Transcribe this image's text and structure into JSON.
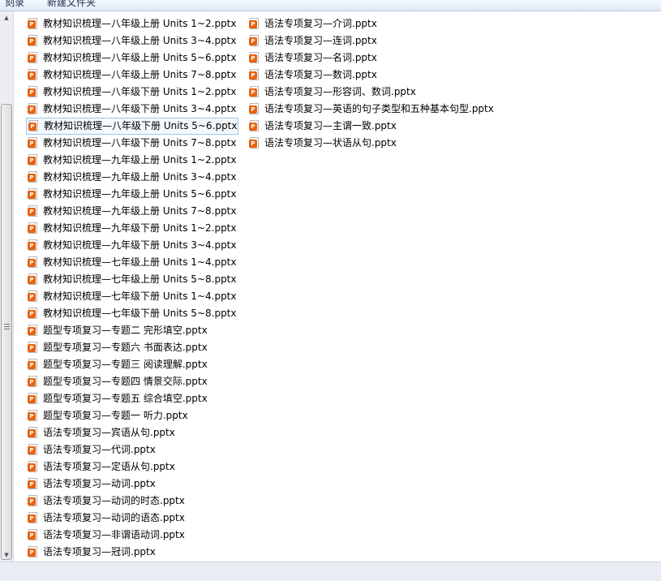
{
  "toolbar": {
    "items": [
      "刻录",
      "新建文件夹"
    ]
  },
  "file_icon_glyph": "P",
  "accent_color": "#e8630f",
  "selected_index": 6,
  "files_column_1": [
    "教材知识梳理—八年级上册 Units 1~2.pptx",
    "教材知识梳理—八年级上册 Units 3~4.pptx",
    "教材知识梳理—八年级上册 Units 5~6.pptx",
    "教材知识梳理—八年级上册 Units 7~8.pptx",
    "教材知识梳理—八年级下册 Units 1~2.pptx",
    "教材知识梳理—八年级下册 Units 3~4.pptx",
    "教材知识梳理—八年级下册 Units 5~6.pptx",
    "教材知识梳理—八年级下册 Units 7~8.pptx",
    "教材知识梳理—九年级上册 Units 1~2.pptx",
    "教材知识梳理—九年级上册 Units 3~4.pptx",
    "教材知识梳理—九年级上册 Units 5~6.pptx",
    "教材知识梳理—九年级上册 Units 7~8.pptx",
    "教材知识梳理—九年级下册 Units 1~2.pptx",
    "教材知识梳理—九年级下册 Units 3~4.pptx",
    "教材知识梳理—七年级上册 Units 1~4.pptx",
    "教材知识梳理—七年级上册 Units 5~8.pptx",
    "教材知识梳理—七年级下册 Units 1~4.pptx",
    "教材知识梳理—七年级下册 Units 5~8.pptx",
    "题型专项复习—专题二  完形填空.pptx",
    "题型专项复习—专题六  书面表达.pptx",
    "题型专项复习—专题三  阅读理解.pptx",
    "题型专项复习—专题四  情景交际.pptx",
    "题型专项复习—专题五  综合填空.pptx",
    "题型专项复习—专题一  听力.pptx",
    "语法专项复习—宾语从句.pptx",
    "语法专项复习—代词.pptx",
    "语法专项复习—定语从句.pptx",
    "语法专项复习—动词.pptx",
    "语法专项复习—动词的时态.pptx",
    "语法专项复习—动词的语态.pptx",
    "语法专项复习—非谓语动词.pptx",
    "语法专项复习—冠词.pptx"
  ],
  "files_column_2": [
    "语法专项复习—介词.pptx",
    "语法专项复习—连词.pptx",
    "语法专项复习—名词.pptx",
    "语法专项复习—数词.pptx",
    "语法专项复习—形容词、数词.pptx",
    "语法专项复习—英语的句子类型和五种基本句型.pptx",
    "语法专项复习—主谓一致.pptx",
    "语法专项复习—状语从句.pptx"
  ]
}
